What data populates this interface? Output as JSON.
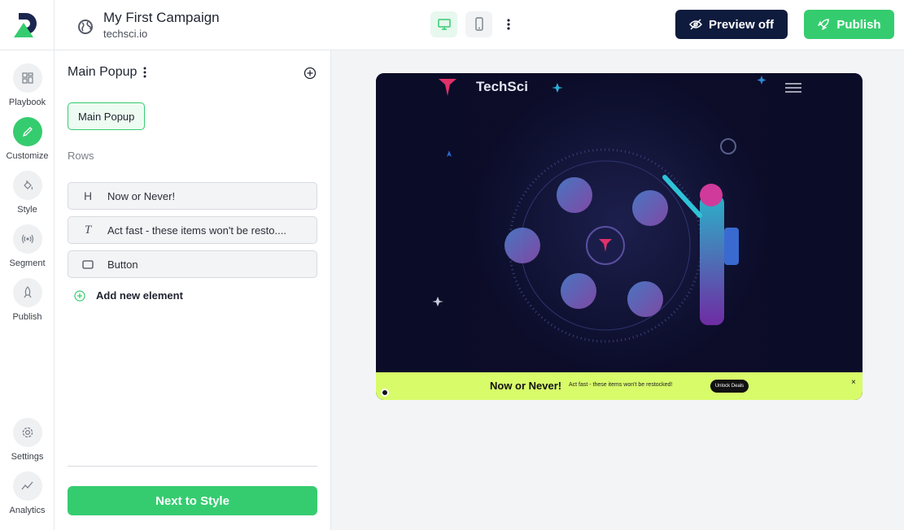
{
  "header": {
    "campaign_title": "My First Campaign",
    "campaign_domain": "techsci.io",
    "preview_label": "Preview off",
    "publish_label": "Publish"
  },
  "rail": {
    "items": [
      {
        "label": "Playbook",
        "icon": "grid-icon"
      },
      {
        "label": "Customize",
        "icon": "pencil-icon",
        "active": true
      },
      {
        "label": "Style",
        "icon": "paint-bucket-icon"
      },
      {
        "label": "Segment",
        "icon": "broadcast-icon"
      },
      {
        "label": "Publish",
        "icon": "rocket-icon"
      },
      {
        "label": "Settings",
        "icon": "gear-icon"
      },
      {
        "label": "Analytics",
        "icon": "trend-icon"
      }
    ]
  },
  "panel": {
    "title": "Main Popup",
    "chip": "Main Popup",
    "rows_label": "Rows",
    "rows": [
      {
        "icon_text": "H",
        "label": "Now or Never!"
      },
      {
        "icon_text": "T",
        "label": "Act fast - these items won't be resto...."
      },
      {
        "icon_text": "",
        "label": "Button"
      }
    ],
    "add_label": "Add new element",
    "next_label": "Next to Style"
  },
  "preview": {
    "brand": "TechSci",
    "bar_title": "Now or Never!",
    "bar_subtitle": "Act fast - these items won't be restocked!",
    "bar_button": "Unlock Deals",
    "bar_close": "×"
  },
  "colors": {
    "accent": "#35cc6f",
    "navy": "#0f1b3d",
    "banner": "#d8fb6a"
  }
}
